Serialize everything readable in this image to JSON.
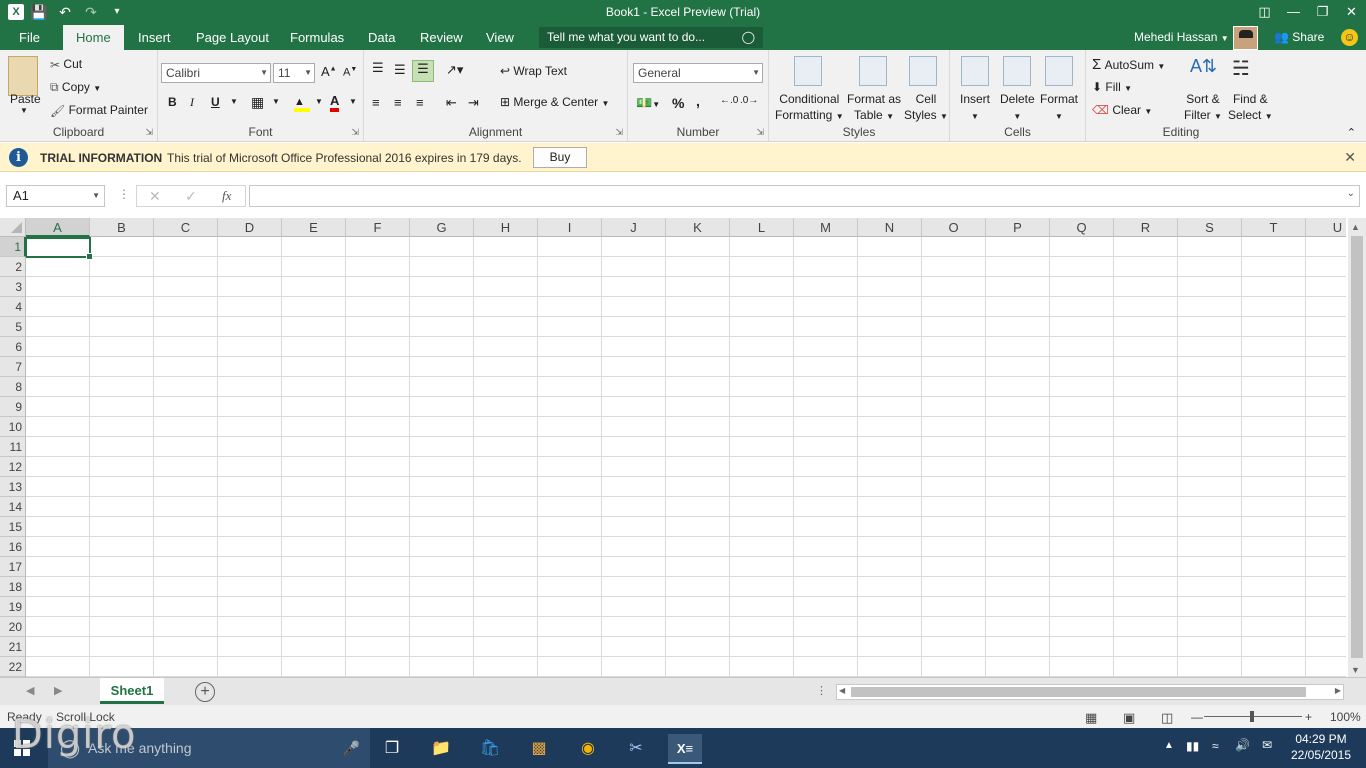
{
  "window": {
    "title": "Book1 - Excel Preview (Trial)"
  },
  "qat": {
    "logo": "X",
    "save_icon": "save-icon",
    "undo_icon": "undo-icon",
    "redo_icon": "redo-icon"
  },
  "tabs": [
    "File",
    "Home",
    "Insert",
    "Page Layout",
    "Formulas",
    "Data",
    "Review",
    "View"
  ],
  "tell_me": "Tell me what you want to do...",
  "user": {
    "name": "Mehedi Hassan",
    "share": "Share"
  },
  "ribbon": {
    "clipboard": {
      "paste": "Paste",
      "cut": "Cut",
      "copy": "Copy",
      "format_painter": "Format Painter",
      "label": "Clipboard"
    },
    "font": {
      "family": "Calibri",
      "size": "11",
      "bold": "B",
      "italic": "I",
      "underline": "U",
      "label": "Font"
    },
    "alignment": {
      "wrap": "Wrap Text",
      "merge": "Merge & Center",
      "label": "Alignment"
    },
    "number": {
      "format": "General",
      "percent": "%",
      "comma": ",",
      "label": "Number"
    },
    "styles": {
      "conditional": [
        "Conditional",
        "Formatting"
      ],
      "format_table": [
        "Format as",
        "Table"
      ],
      "cell_styles": [
        "Cell",
        "Styles"
      ],
      "label": "Styles"
    },
    "cells": {
      "insert": "Insert",
      "delete": "Delete",
      "format": "Format",
      "label": "Cells"
    },
    "editing": {
      "autosum": "AutoSum",
      "fill": "Fill",
      "clear": "Clear",
      "sort": [
        "Sort &",
        "Filter"
      ],
      "find": [
        "Find &",
        "Select"
      ],
      "label": "Editing"
    }
  },
  "trial": {
    "label": "TRIAL INFORMATION",
    "message": "This trial of Microsoft Office Professional 2016 expires in 179 days.",
    "buy": "Buy"
  },
  "formula_bar": {
    "name_box": "A1",
    "fx": "fx",
    "value": ""
  },
  "columns": [
    "A",
    "B",
    "C",
    "D",
    "E",
    "F",
    "G",
    "H",
    "I",
    "J",
    "K",
    "L",
    "M",
    "N",
    "O",
    "P",
    "Q",
    "R",
    "S",
    "T",
    "U"
  ],
  "rows": [
    "1",
    "2",
    "3",
    "4",
    "5",
    "6",
    "7",
    "8",
    "9",
    "10",
    "11",
    "12",
    "13",
    "14",
    "15",
    "16",
    "17",
    "18",
    "19",
    "20",
    "21",
    "22"
  ],
  "sheet": {
    "name": "Sheet1"
  },
  "status": {
    "ready": "Ready",
    "scroll_lock": "Scroll Lock",
    "zoom": "100%"
  },
  "taskbar": {
    "search": "Ask me anything",
    "time": "04:29 PM",
    "date": "22/05/2015"
  },
  "watermark": "Digiro",
  "colors": {
    "excel_green": "#217346",
    "trial_bg": "#fff4ce",
    "taskbar": "#1e3a5a"
  }
}
